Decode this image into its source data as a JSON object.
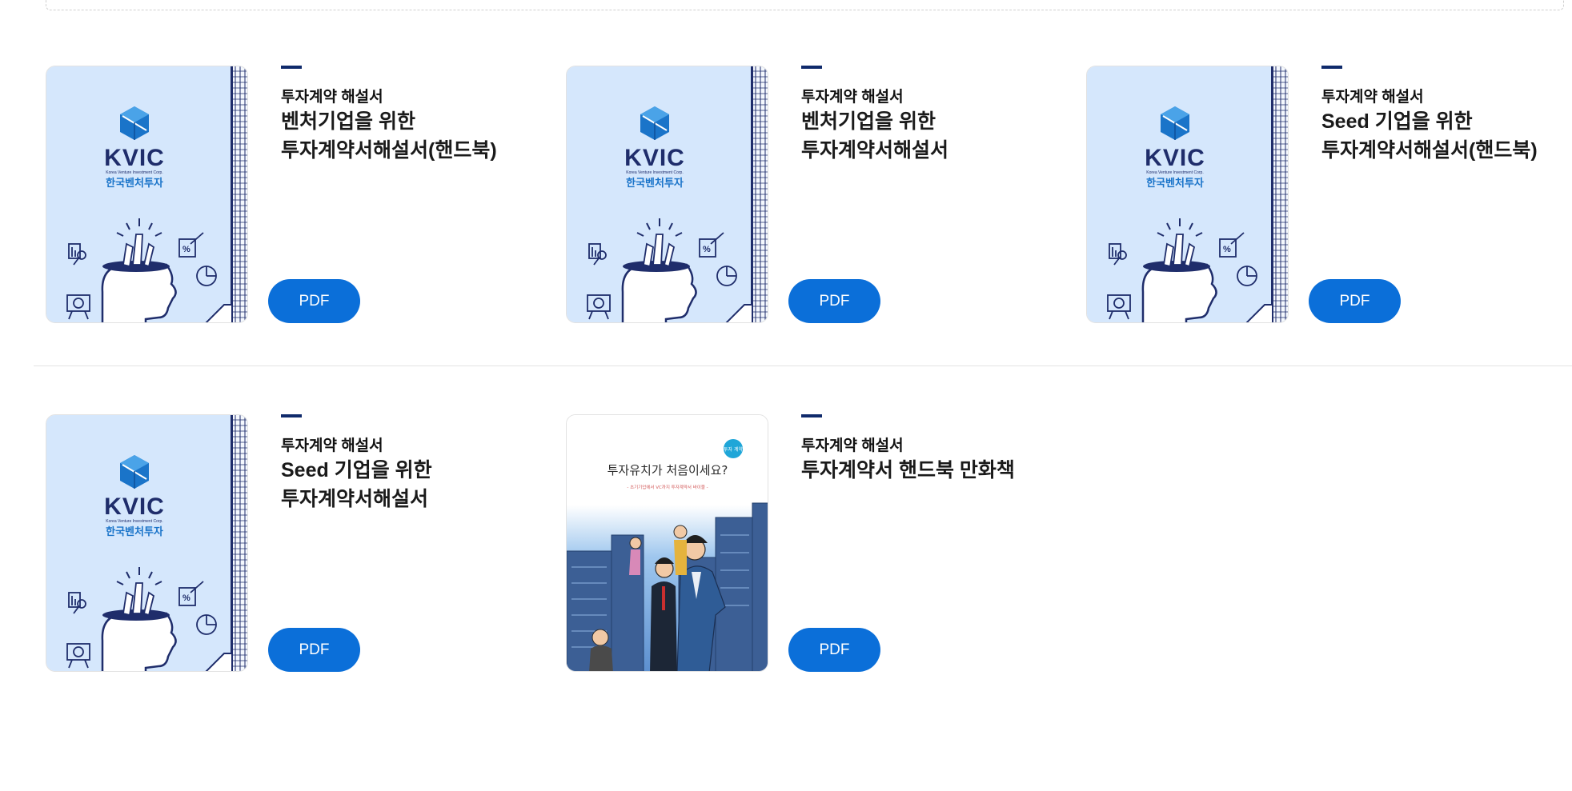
{
  "cards": [
    {
      "category": "투자계약 해설서",
      "title_line1": "벤처기업을 위한",
      "title_line2": "투자계약서해설서(핸드북)",
      "button": "PDF",
      "cover": "kvic"
    },
    {
      "category": "투자계약 해설서",
      "title_line1": "벤처기업을 위한",
      "title_line2": "투자계약서해설서",
      "button": "PDF",
      "cover": "kvic"
    },
    {
      "category": "투자계약 해설서",
      "title_line1": "Seed 기업을 위한",
      "title_line2": "투자계약서해설서(핸드북)",
      "button": "PDF",
      "cover": "kvic"
    },
    {
      "category": "투자계약 해설서",
      "title_line1": "Seed 기업을 위한",
      "title_line2": "투자계약서해설서",
      "button": "PDF",
      "cover": "kvic"
    },
    {
      "category": "투자계약 해설서",
      "title_line1": "투자계약서 핸드북 만화책",
      "title_line2": "",
      "button": "PDF",
      "cover": "comic"
    }
  ],
  "kvic_cover": {
    "logo_text": "KVIC",
    "corp_en": "Korea Venture Investment Corp.",
    "corp_ko": "한국벤처투자"
  },
  "comic_cover": {
    "badge": "투자 계약",
    "headline": "투자유치가 처음이세요?",
    "subline": "- 초기기업에서 VC까지 투자계약서 바이블 -"
  },
  "colors": {
    "accent": "#0b6fd9",
    "navy": "#0f2a6b",
    "cover_bg": "#cfe3fb"
  }
}
